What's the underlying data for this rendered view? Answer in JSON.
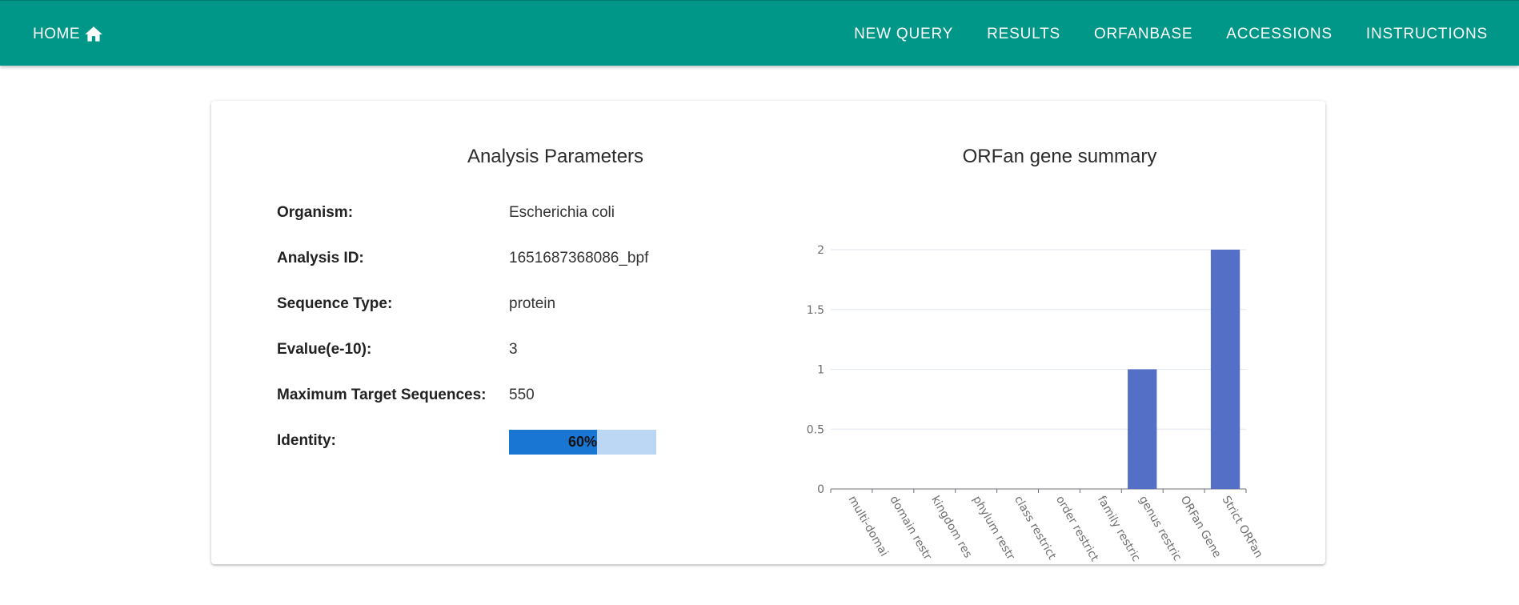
{
  "nav": {
    "home_label": "HOME",
    "items": [
      "NEW QUERY",
      "RESULTS",
      "ORFANBASE",
      "ACCESSIONS",
      "INSTRUCTIONS"
    ]
  },
  "params": {
    "title": "Analysis Parameters",
    "rows": [
      {
        "label": "Organism:",
        "value": "Escherichia coli"
      },
      {
        "label": "Analysis ID:",
        "value": "1651687368086_bpf"
      },
      {
        "label": "Sequence Type:",
        "value": "protein"
      },
      {
        "label": "Evalue(e-10):",
        "value": "3"
      },
      {
        "label": "Maximum Target Sequences:",
        "value": "550"
      },
      {
        "label": "Identity:",
        "value": ""
      }
    ],
    "identity": {
      "percent": 60,
      "text": "60%"
    }
  },
  "colors": {
    "header": "#009688",
    "bar": "#5470c6",
    "identity_fill": "#1976d2",
    "identity_track": "#bbd7f3"
  },
  "chart_title": "ORFan gene summary",
  "chart_data": {
    "type": "bar",
    "categories": [
      "multi-domai",
      "domain restr",
      "kingdom res",
      "phylum restr",
      "class restrict",
      "order restrict",
      "family restric",
      "genus restric",
      "ORFan Gene",
      "Strict ORFan"
    ],
    "values": [
      0,
      0,
      0,
      0,
      0,
      0,
      0,
      1,
      0,
      2
    ],
    "yticks": [
      "0",
      "0.5",
      "1",
      "1.5",
      "2"
    ],
    "ylim": [
      0,
      2
    ],
    "grid": true
  }
}
